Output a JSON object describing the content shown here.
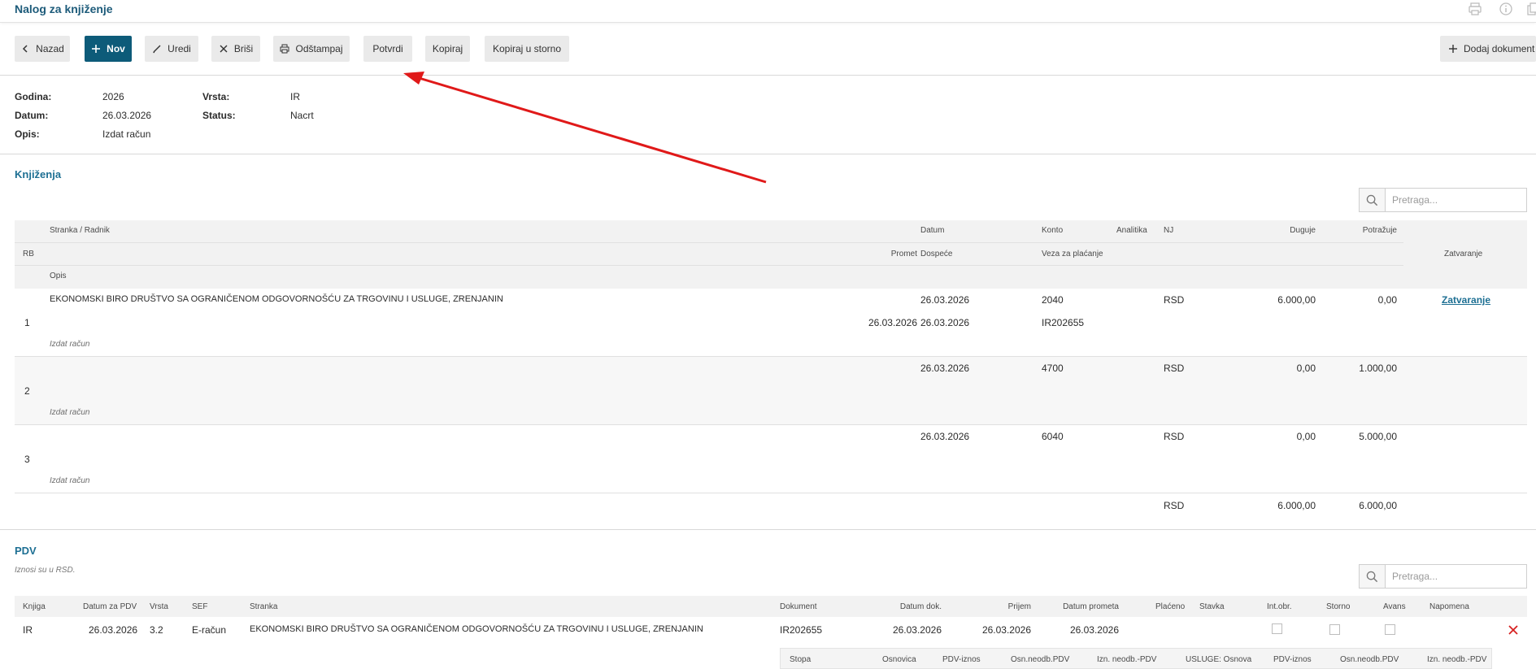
{
  "header": {
    "title": "Nalog za knjiženje",
    "icons": [
      "print-icon",
      "info-icon",
      "copy-icon"
    ]
  },
  "toolbar": {
    "back": "Nazad",
    "new": "Nov",
    "edit": "Uredi",
    "delete": "Briši",
    "print": "Odštampaj",
    "confirm": "Potvrdi",
    "copy": "Kopiraj",
    "copy_storno": "Kopiraj u storno",
    "add_document": "Dodaj dokument"
  },
  "info": {
    "godina_label": "Godina:",
    "godina": "2026",
    "datum_label": "Datum:",
    "datum": "26.03.2026",
    "opis_label": "Opis:",
    "opis": "Izdat račun",
    "vrsta_label": "Vrsta:",
    "vrsta": "IR",
    "status_label": "Status:",
    "status": "Nacrt"
  },
  "knjizenja": {
    "title": "Knjiženja",
    "search_placeholder": "Pretraga...",
    "headers": {
      "rb": "RB",
      "stranka": "Stranka / Radnik",
      "opis": "Opis",
      "promet": "Promet",
      "datum": "Datum",
      "dospece": "Dospeće",
      "konto": "Konto",
      "veza": "Veza za plaćanje",
      "analitika": "Analitika",
      "nj": "NJ",
      "duguje": "Duguje",
      "potrazuje": "Potražuje",
      "zatvaranje": "Zatvaranje"
    },
    "rows": [
      {
        "rb": "1",
        "stranka": "EKONOMSKI BIRO DRUŠTVO SA OGRANIČENOM ODGOVORNOŠĆU ZA TRGOVINU I USLUGE, ZRENJANIN",
        "promet": "26.03.2026",
        "datum": "26.03.2026",
        "dospece": "26.03.2026",
        "konto": "2040",
        "veza": "IR202655",
        "nj": "RSD",
        "duguje": "6.000,00",
        "potrazuje": "0,00",
        "zatvaranje": "Zatvaranje",
        "opis": "Izdat račun"
      },
      {
        "rb": "2",
        "stranka": "",
        "promet": "",
        "datum": "26.03.2026",
        "dospece": "",
        "konto": "4700",
        "veza": "",
        "nj": "RSD",
        "duguje": "0,00",
        "potrazuje": "1.000,00",
        "zatvaranje": "",
        "opis": "Izdat račun"
      },
      {
        "rb": "3",
        "stranka": "",
        "promet": "",
        "datum": "26.03.2026",
        "dospece": "",
        "konto": "6040",
        "veza": "",
        "nj": "RSD",
        "duguje": "0,00",
        "potrazuje": "5.000,00",
        "zatvaranje": "",
        "opis": "Izdat račun"
      }
    ],
    "totals": {
      "nj": "RSD",
      "duguje": "6.000,00",
      "potrazuje": "6.000,00"
    }
  },
  "pdv": {
    "title": "PDV",
    "note": "Iznosi su u RSD.",
    "search_placeholder": "Pretraga...",
    "headers": {
      "knjiga": "Knjiga",
      "datum_pdv": "Datum za PDV",
      "vrsta": "Vrsta",
      "sef": "SEF",
      "stranka": "Stranka",
      "dokument": "Dokument",
      "datum_dok": "Datum dok.",
      "prijem": "Prijem",
      "datum_prometa": "Datum prometa",
      "placeno": "Plaćeno",
      "stavka": "Stavka",
      "int_obr": "Int.obr.",
      "storno": "Storno",
      "avans": "Avans",
      "napomena": "Napomena"
    },
    "row": {
      "knjiga": "IR",
      "datum_pdv": "26.03.2026",
      "vrsta": "3.2",
      "sef": "E-račun",
      "stranka": "EKONOMSKI BIRO DRUŠTVO SA OGRANIČENOM ODGOVORNOŠĆU ZA TRGOVINU I USLUGE, ZRENJANIN",
      "dokument": "IR202655",
      "datum_dok": "26.03.2026",
      "prijem": "26.03.2026",
      "datum_prometa": "26.03.2026"
    },
    "sub_headers": [
      "Stopa",
      "Osnovica",
      "PDV-iznos",
      "Osn.neodb.PDV",
      "Izn. neodb.-PDV",
      "USLUGE: Osnova",
      "PDV-iznos",
      "Osn.neodb.PDV",
      "Izn. neodb.-PDV"
    ]
  },
  "colors": {
    "accent": "#0d5b79",
    "title": "#1d6f93",
    "arrow": "#e01919",
    "delete": "#d62020"
  }
}
